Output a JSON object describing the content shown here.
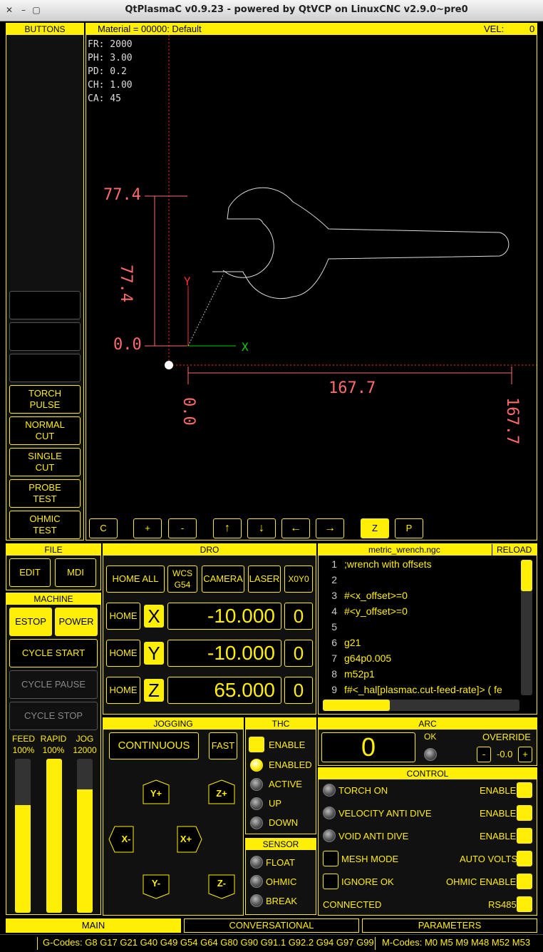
{
  "window": {
    "title": "QtPlasmaC v0.9.23 - powered by QtVCP on LinuxCNC v2.9.0~pre0",
    "close": "✕",
    "min": "–",
    "max": "▢"
  },
  "buttons_panel": {
    "header": "BUTTONS",
    "items": [
      "",
      "",
      "",
      "TORCH\nPULSE",
      "NORMAL\nCUT",
      "SINGLE\nCUT",
      "PROBE\nTEST",
      "OHMIC\nTEST"
    ]
  },
  "preview": {
    "material": "Material = 00000: Default",
    "vel_label": "VEL:",
    "vel_value": "0",
    "info": [
      "FR: 2000",
      "PH: 3.00",
      "PD: 0.2",
      "CH: 1.00",
      "CA: 45"
    ],
    "dims": {
      "y_top": "77.4",
      "y_zero": "0.0",
      "y_side": "77.4",
      "x_len": "167.7",
      "x_zero": "0.0",
      "x_end": "167.7"
    },
    "axes": {
      "x": "X",
      "y": "Y"
    },
    "view_buttons": [
      "C",
      "+",
      "-",
      "↑",
      "↓",
      "←",
      "→",
      "Z",
      "P"
    ]
  },
  "file": {
    "header": "FILE",
    "edit": "EDIT",
    "mdi": "MDI"
  },
  "machine": {
    "header": "MACHINE",
    "estop": "ESTOP",
    "power": "POWER",
    "cycle_start": "CYCLE START",
    "cycle_pause": "CYCLE PAUSE",
    "cycle_stop": "CYCLE STOP"
  },
  "overrides": {
    "feed_label": "FEED",
    "feed_value": "100%",
    "rapid_label": "RAPID",
    "rapid_value": "100%",
    "jog_label": "JOG",
    "jog_value": "12000",
    "feed_level": 0.7,
    "rapid_level": 1.0,
    "jog_level": 0.8
  },
  "dro": {
    "header": "DRO",
    "home_all": "HOME ALL",
    "wcs": "WCS\nG54",
    "camera": "CAMERA",
    "laser": "LASER",
    "x0y0": "X0Y0",
    "axes": [
      {
        "home": "HOME",
        "axis": "X",
        "value": "-10.000",
        "zero": "0"
      },
      {
        "home": "HOME",
        "axis": "Y",
        "value": "-10.000",
        "zero": "0"
      },
      {
        "home": "HOME",
        "axis": "Z",
        "value": "65.000",
        "zero": "0"
      }
    ]
  },
  "gcode": {
    "filename": "metric_wrench.ngc",
    "reload": "RELOAD",
    "lines": [
      {
        "n": "1",
        "t": ";wrench with offsets"
      },
      {
        "n": "2",
        "t": ""
      },
      {
        "n": "3",
        "t": "#<x_offset>=0"
      },
      {
        "n": "4",
        "t": "#<y_offset>=0"
      },
      {
        "n": "5",
        "t": ""
      },
      {
        "n": "6",
        "t": "g21"
      },
      {
        "n": "7",
        "t": "g64p0.005"
      },
      {
        "n": "8",
        "t": "m52p1"
      },
      {
        "n": "9",
        "t": "f#<_hal[plasmac.cut-feed-rate]> ( fe"
      }
    ]
  },
  "jogging": {
    "header": "JOGGING",
    "continuous": "CONTINUOUS",
    "fast": "FAST",
    "yplus": "Y+",
    "zplus": "Z+",
    "xminus": "X-",
    "xplus": "X+",
    "yminus": "Y-",
    "zminus": "Z-"
  },
  "thc": {
    "header": "THC",
    "enable": "ENABLE",
    "enabled": "ENABLED",
    "active": "ACTIVE",
    "up": "UP",
    "down": "DOWN"
  },
  "sensor": {
    "header": "SENSOR",
    "float": "FLOAT",
    "ohmic": "OHMIC",
    "break": "BREAK"
  },
  "arc": {
    "header": "ARC",
    "value": "0",
    "ok": "OK",
    "override": "OVERRIDE",
    "minus": "-",
    "ov_value": "-0.0",
    "plus": "+"
  },
  "control": {
    "header": "CONTROL",
    "rows": [
      {
        "left": "TORCH ON",
        "right": "ENABLE"
      },
      {
        "left": "VELOCITY ANTI DIVE",
        "right": "ENABLE"
      },
      {
        "left": "VOID ANTI DIVE",
        "right": "ENABLE"
      },
      {
        "left": "MESH MODE",
        "right": "AUTO VOLTS"
      },
      {
        "left": "IGNORE OK",
        "right": "OHMIC ENABLE"
      },
      {
        "left": "CONNECTED",
        "right": "RS485"
      }
    ]
  },
  "tabs": [
    "MAIN",
    "CONVERSATIONAL",
    "PARAMETERS"
  ],
  "status": {
    "gcodes": "G-Codes: G8 G17 G21 G40 G49 G54 G64 G80 G90 G91.1 G92.2 G94 G97 G99",
    "mcodes": "M-Codes: M0 M5 M9 M48 M52 M53"
  },
  "colors": {
    "accent": "#ffee06",
    "dim": "#ff6b6b",
    "bg": "#000000"
  }
}
